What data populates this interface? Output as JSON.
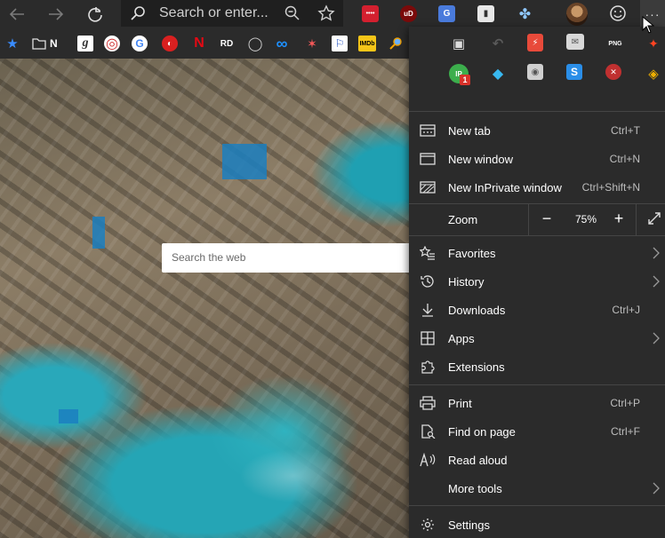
{
  "toolbar": {
    "address_placeholder": "Search or enter...",
    "back_icon": "back-arrow-icon",
    "forward_icon": "forward-arrow-icon",
    "refresh_icon": "refresh-icon",
    "more_label": "···",
    "extensions": [
      {
        "name": "ext-lastpass",
        "color": "#d3202f",
        "glyph": "••••"
      },
      {
        "name": "ext-ublock",
        "color": "#800000",
        "glyph": "uD"
      },
      {
        "name": "ext-translate",
        "color": "#4a7bdc",
        "glyph": "G"
      },
      {
        "name": "ext-page-tool",
        "color": "#e8e8e8",
        "glyph": "▮"
      },
      {
        "name": "ext-network",
        "color": "#2b2b2b",
        "glyph": "✤"
      }
    ]
  },
  "favorites": {
    "items": [
      {
        "name": "favorites-star",
        "label": "★",
        "color": "#2b2b2b",
        "fg": "#3a8cff"
      },
      {
        "name": "folder-n",
        "label": "N",
        "color": "#2b2b2b",
        "fg": "#ffffff"
      },
      {
        "name": "fav-g-italic",
        "label": "g",
        "color": "#ffffff",
        "fg": "#333333"
      },
      {
        "name": "fav-lifebuoy",
        "label": "◎",
        "color": "#e8e8e8",
        "fg": "#d03030"
      },
      {
        "name": "fav-google",
        "label": "G",
        "color": "#ffffff",
        "fg": "#4285f4"
      },
      {
        "name": "fav-red-circle",
        "label": "●",
        "color": "#2b2b2b",
        "fg": "#d92020"
      },
      {
        "name": "fav-netflix",
        "label": "N",
        "color": "#2b2b2b",
        "fg": "#e50914"
      },
      {
        "name": "fav-rd",
        "label": "RD",
        "color": "#2b2b2b",
        "fg": "#ffffff"
      },
      {
        "name": "fav-ring",
        "label": "◯",
        "color": "#2b2b2b",
        "fg": "#cfcfcf"
      },
      {
        "name": "fav-infinity",
        "label": "∞",
        "color": "#2b2b2b",
        "fg": "#1e90ff"
      },
      {
        "name": "fav-colorful",
        "label": "✶",
        "color": "#2b2b2b",
        "fg": "#ff5a5a"
      },
      {
        "name": "fav-blue-figure",
        "label": "⚐",
        "color": "#ffffff",
        "fg": "#2050c0"
      },
      {
        "name": "fav-imdb",
        "label": "IMDb",
        "color": "#f5c518",
        "fg": "#000000"
      },
      {
        "name": "fav-magnifier",
        "label": "🔍",
        "color": "#2b2b2b",
        "fg": "#f0a000"
      }
    ]
  },
  "page": {
    "search_placeholder": "Search the web"
  },
  "menu": {
    "extension_icons": [
      {
        "name": "menu-ext-window",
        "glyph": "▣",
        "color": "#2b2b2b",
        "fg": "#dddddd"
      },
      {
        "name": "menu-ext-arrow",
        "glyph": "↶",
        "color": "#2b2b2b",
        "fg": "#5a5a5a"
      },
      {
        "name": "menu-ext-pdf",
        "glyph": "⚡",
        "color": "#e84a3a",
        "fg": "#ffffff"
      },
      {
        "name": "menu-ext-mail",
        "glyph": "✉",
        "color": "#d8d8d8",
        "fg": "#555555"
      },
      {
        "name": "menu-ext-text",
        "glyph": "PNG",
        "color": "#2b2b2b",
        "fg": "#ffffff"
      },
      {
        "name": "menu-ext-spark",
        "glyph": "✦",
        "color": "#2b2b2b",
        "fg": "#ff4422"
      },
      {
        "name": "menu-ext-ip",
        "glyph": "IP",
        "color": "#3cae4c",
        "fg": "#ffffff"
      },
      {
        "name": "menu-ext-diamond",
        "glyph": "◆",
        "color": "#2b2b2b",
        "fg": "#38b8f0"
      },
      {
        "name": "menu-ext-lens",
        "glyph": "◉",
        "color": "#cfcfcf",
        "fg": "#555555"
      },
      {
        "name": "menu-ext-s",
        "glyph": "S",
        "color": "#2a8ee8",
        "fg": "#ffffff"
      },
      {
        "name": "menu-ext-x",
        "glyph": "✕",
        "color": "#c03030",
        "fg": "#ffffff"
      },
      {
        "name": "menu-ext-ring",
        "glyph": "◈",
        "color": "#2b2b2b",
        "fg": "#f0b000"
      }
    ],
    "badge": "1",
    "new_tab": {
      "label": "New tab",
      "shortcut": "Ctrl+T"
    },
    "new_window": {
      "label": "New window",
      "shortcut": "Ctrl+N"
    },
    "new_inprivate": {
      "label": "New InPrivate window",
      "shortcut": "Ctrl+Shift+N"
    },
    "zoom": {
      "label": "Zoom",
      "minus": "−",
      "value": "75%",
      "plus": "+"
    },
    "favorites": {
      "label": "Favorites"
    },
    "history": {
      "label": "History"
    },
    "downloads": {
      "label": "Downloads",
      "shortcut": "Ctrl+J"
    },
    "apps": {
      "label": "Apps"
    },
    "extensions": {
      "label": "Extensions"
    },
    "print": {
      "label": "Print",
      "shortcut": "Ctrl+P"
    },
    "find": {
      "label": "Find on page",
      "shortcut": "Ctrl+F"
    },
    "read_aloud": {
      "label": "Read aloud"
    },
    "more_tools": {
      "label": "More tools"
    },
    "settings": {
      "label": "Settings"
    }
  }
}
